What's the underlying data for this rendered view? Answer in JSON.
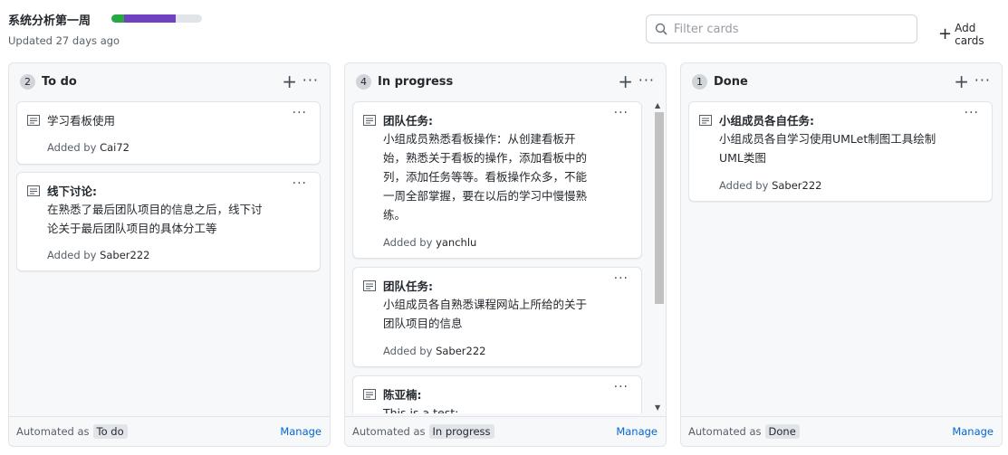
{
  "board": {
    "title": "系统分析第一周",
    "updated": "Updated 27 days ago",
    "progress": {
      "done_fraction": 0.143,
      "in_progress_fraction": 0.571,
      "done_color": "#28a745",
      "in_progress_color": "#6f42c1",
      "todo_color": "#e1e4e8"
    }
  },
  "toolbar": {
    "filter_placeholder": "Filter cards",
    "add_cards_label": "Add cards"
  },
  "columns": [
    {
      "name": "To do",
      "count": "2",
      "automated_label": "Automated as",
      "automated_value": "To do",
      "manage_label": "Manage",
      "cards": [
        {
          "title": "学习看板使用",
          "bold": false,
          "body": [],
          "added_label": "Added by",
          "user": "Cai72"
        },
        {
          "title": "线下讨论:",
          "bold": true,
          "body": [
            "在熟悉了最后团队项目的信息之后，线下讨",
            "论关于最后团队项目的具体分工等"
          ],
          "added_label": "Added by",
          "user": "Saber222"
        }
      ]
    },
    {
      "name": "In progress",
      "count": "4",
      "automated_label": "Automated as",
      "automated_value": "In progress",
      "manage_label": "Manage",
      "cards": [
        {
          "title": "团队任务:",
          "bold": true,
          "body": [
            "小组成员熟悉看板操作：从创建看板开",
            "始，熟悉关于看板的操作，添加看板中的",
            "列，添加任务等等。看板操作众多，不能",
            "一周全部掌握，要在以后的学习中慢慢熟",
            "练。"
          ],
          "added_label": "Added by",
          "user": "yanchlu"
        },
        {
          "title": "团队任务:",
          "bold": true,
          "body": [
            "小组成员各自熟悉课程网站上所给的关于",
            "团队项目的信息"
          ],
          "added_label": "Added by",
          "user": "Saber222"
        },
        {
          "title": "陈亚楠:",
          "bold": true,
          "body": [
            "This is a test:"
          ],
          "added_label": "",
          "user": ""
        }
      ]
    },
    {
      "name": "Done",
      "count": "1",
      "automated_label": "Automated as",
      "automated_value": "Done",
      "manage_label": "Manage",
      "cards": [
        {
          "title": "小组成员各自任务:",
          "bold": true,
          "body": [
            "小组成员各自学习使用UMLet制图工具绘制",
            "UML类图"
          ],
          "added_label": "Added by",
          "user": "Saber222"
        }
      ]
    }
  ]
}
